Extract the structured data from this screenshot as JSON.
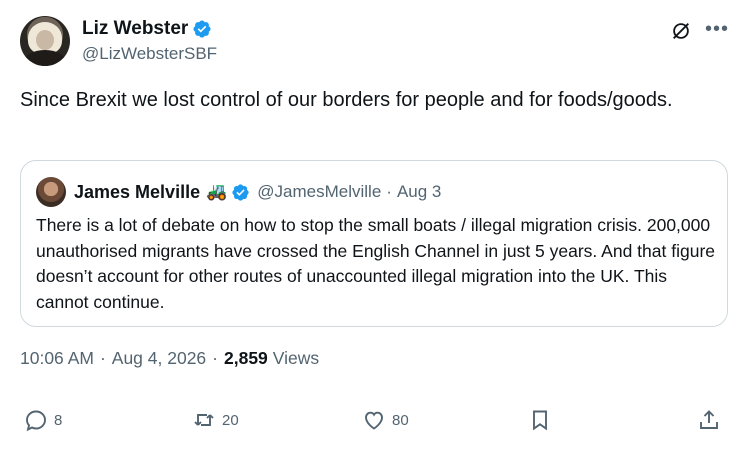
{
  "author": {
    "display_name": "Liz Webster",
    "handle": "@LizWebsterSBF"
  },
  "tweet": {
    "text": "Since Brexit we lost control of our borders for people and for foods/goods."
  },
  "quoted": {
    "display_name": "James Melville",
    "emoji": "🚜",
    "handle": "@JamesMelville",
    "separator": "·",
    "date": "Aug 3",
    "text": "There is a lot of debate on how to stop the small boats / illegal migration crisis. 200,000 unauthorised migrants have crossed the English Channel in just 5 years. And that figure doesn’t account for other routes of unaccounted illegal migration into the UK. This cannot continue."
  },
  "meta": {
    "time": "10:06 AM",
    "sep1": "·",
    "date": "Aug 4, 2026",
    "sep2": "·",
    "views_count": "2,859",
    "views_label": "Views"
  },
  "actions": {
    "replies": "8",
    "reposts": "20",
    "likes": "80"
  },
  "colors": {
    "verified": "#1d9bf0",
    "secondary_text": "#536471",
    "border": "#cfd9de"
  },
  "icons": [
    "verified-badge-icon",
    "grok-icon",
    "more-icon",
    "reply-icon",
    "repost-icon",
    "like-icon",
    "bookmark-icon",
    "share-icon",
    "tractor-emoji"
  ]
}
